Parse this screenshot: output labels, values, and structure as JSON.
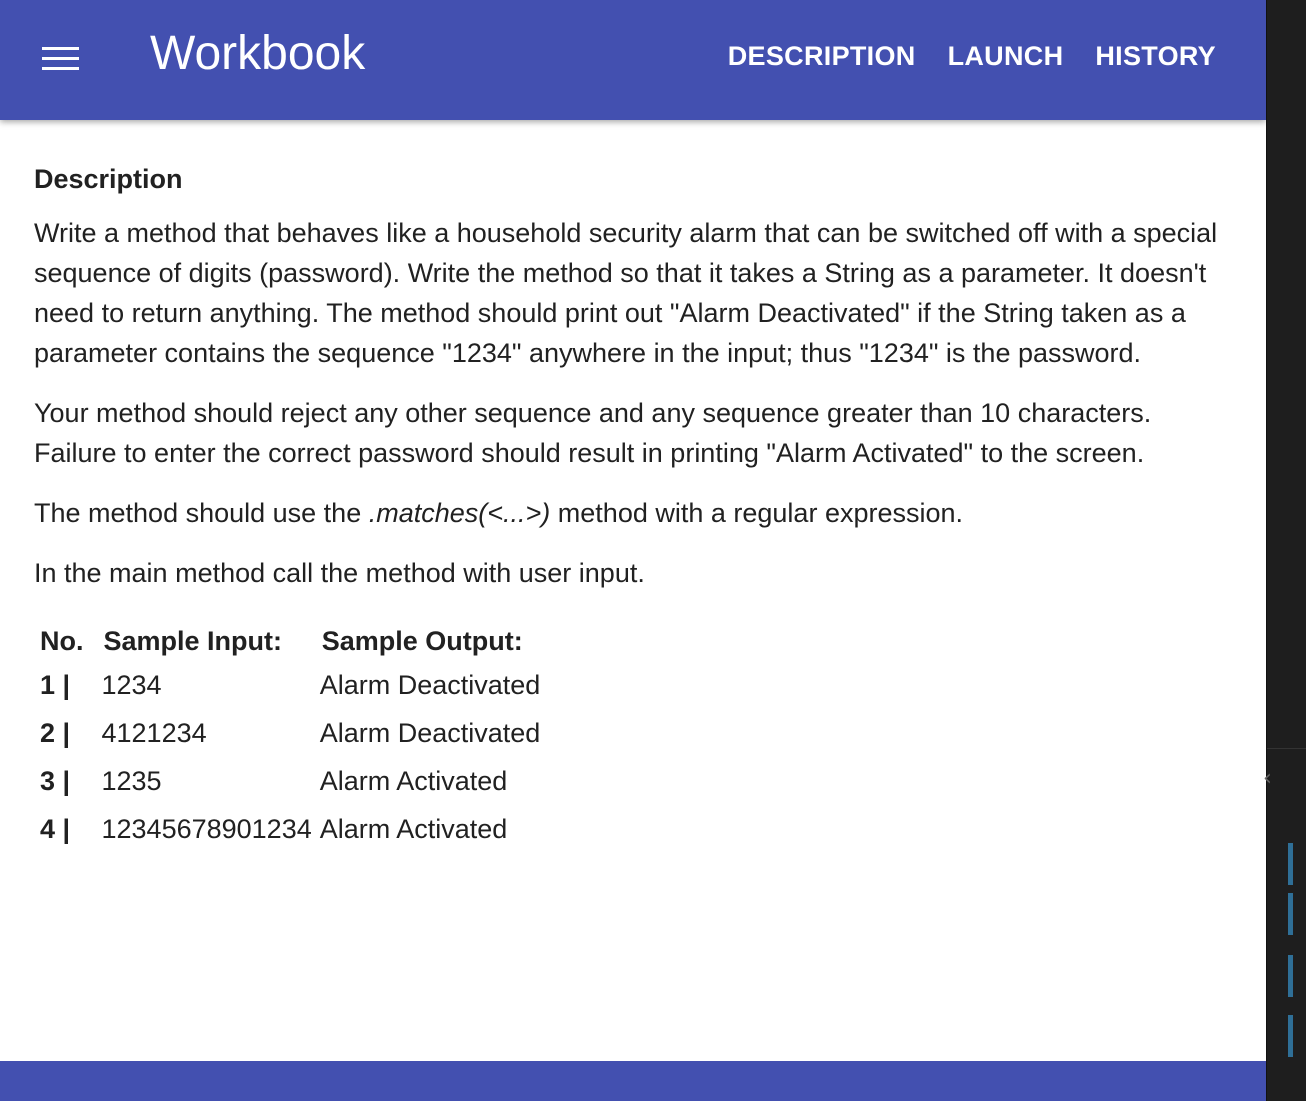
{
  "header": {
    "menu_icon": "hamburger-menu-icon",
    "title": "Workbook",
    "nav": [
      {
        "label": "DESCRIPTION"
      },
      {
        "label": "LAUNCH"
      },
      {
        "label": "HISTORY"
      }
    ]
  },
  "colors": {
    "primary": "#4350b0",
    "text": "#212121",
    "side_panel": "#1e1e1e",
    "side_marks": "#2f6f97"
  },
  "description": {
    "heading": "Description",
    "para1": "Write a method that behaves like a household security alarm that can be switched off with a special sequence of digits (password). Write the method so that it takes a String as a parameter. It doesn't need to return anything. The method should print out \"Alarm Deactivated\" if the String taken as a parameter contains the sequence \"1234\" anywhere in the input; thus \"1234\" is the password.",
    "para2": "Your method should reject any other sequence and any sequence greater than 10 characters. Failure to enter the correct password should result in printing \"Alarm Activated\" to the screen.",
    "para3_before": "The method should use the ",
    "para3_code": ".matches(<...>)",
    "para3_after": " method with a regular expression.",
    "para4": "In the main method call the method with user input."
  },
  "samples": {
    "headers": {
      "no": "No.",
      "input": "Sample Input:",
      "output": "Sample Output:"
    },
    "rows": [
      {
        "no": "1 |",
        "input": "1234",
        "output": "Alarm Deactivated"
      },
      {
        "no": "2 |",
        "input": "4121234",
        "output": "Alarm Deactivated"
      },
      {
        "no": "3 |",
        "input": "1235",
        "output": "Alarm Activated"
      },
      {
        "no": "4 |",
        "input": "12345678901234",
        "output": "Alarm Activated"
      }
    ]
  },
  "side_panel": {
    "chevron_icon": "chevron-left-icon"
  }
}
